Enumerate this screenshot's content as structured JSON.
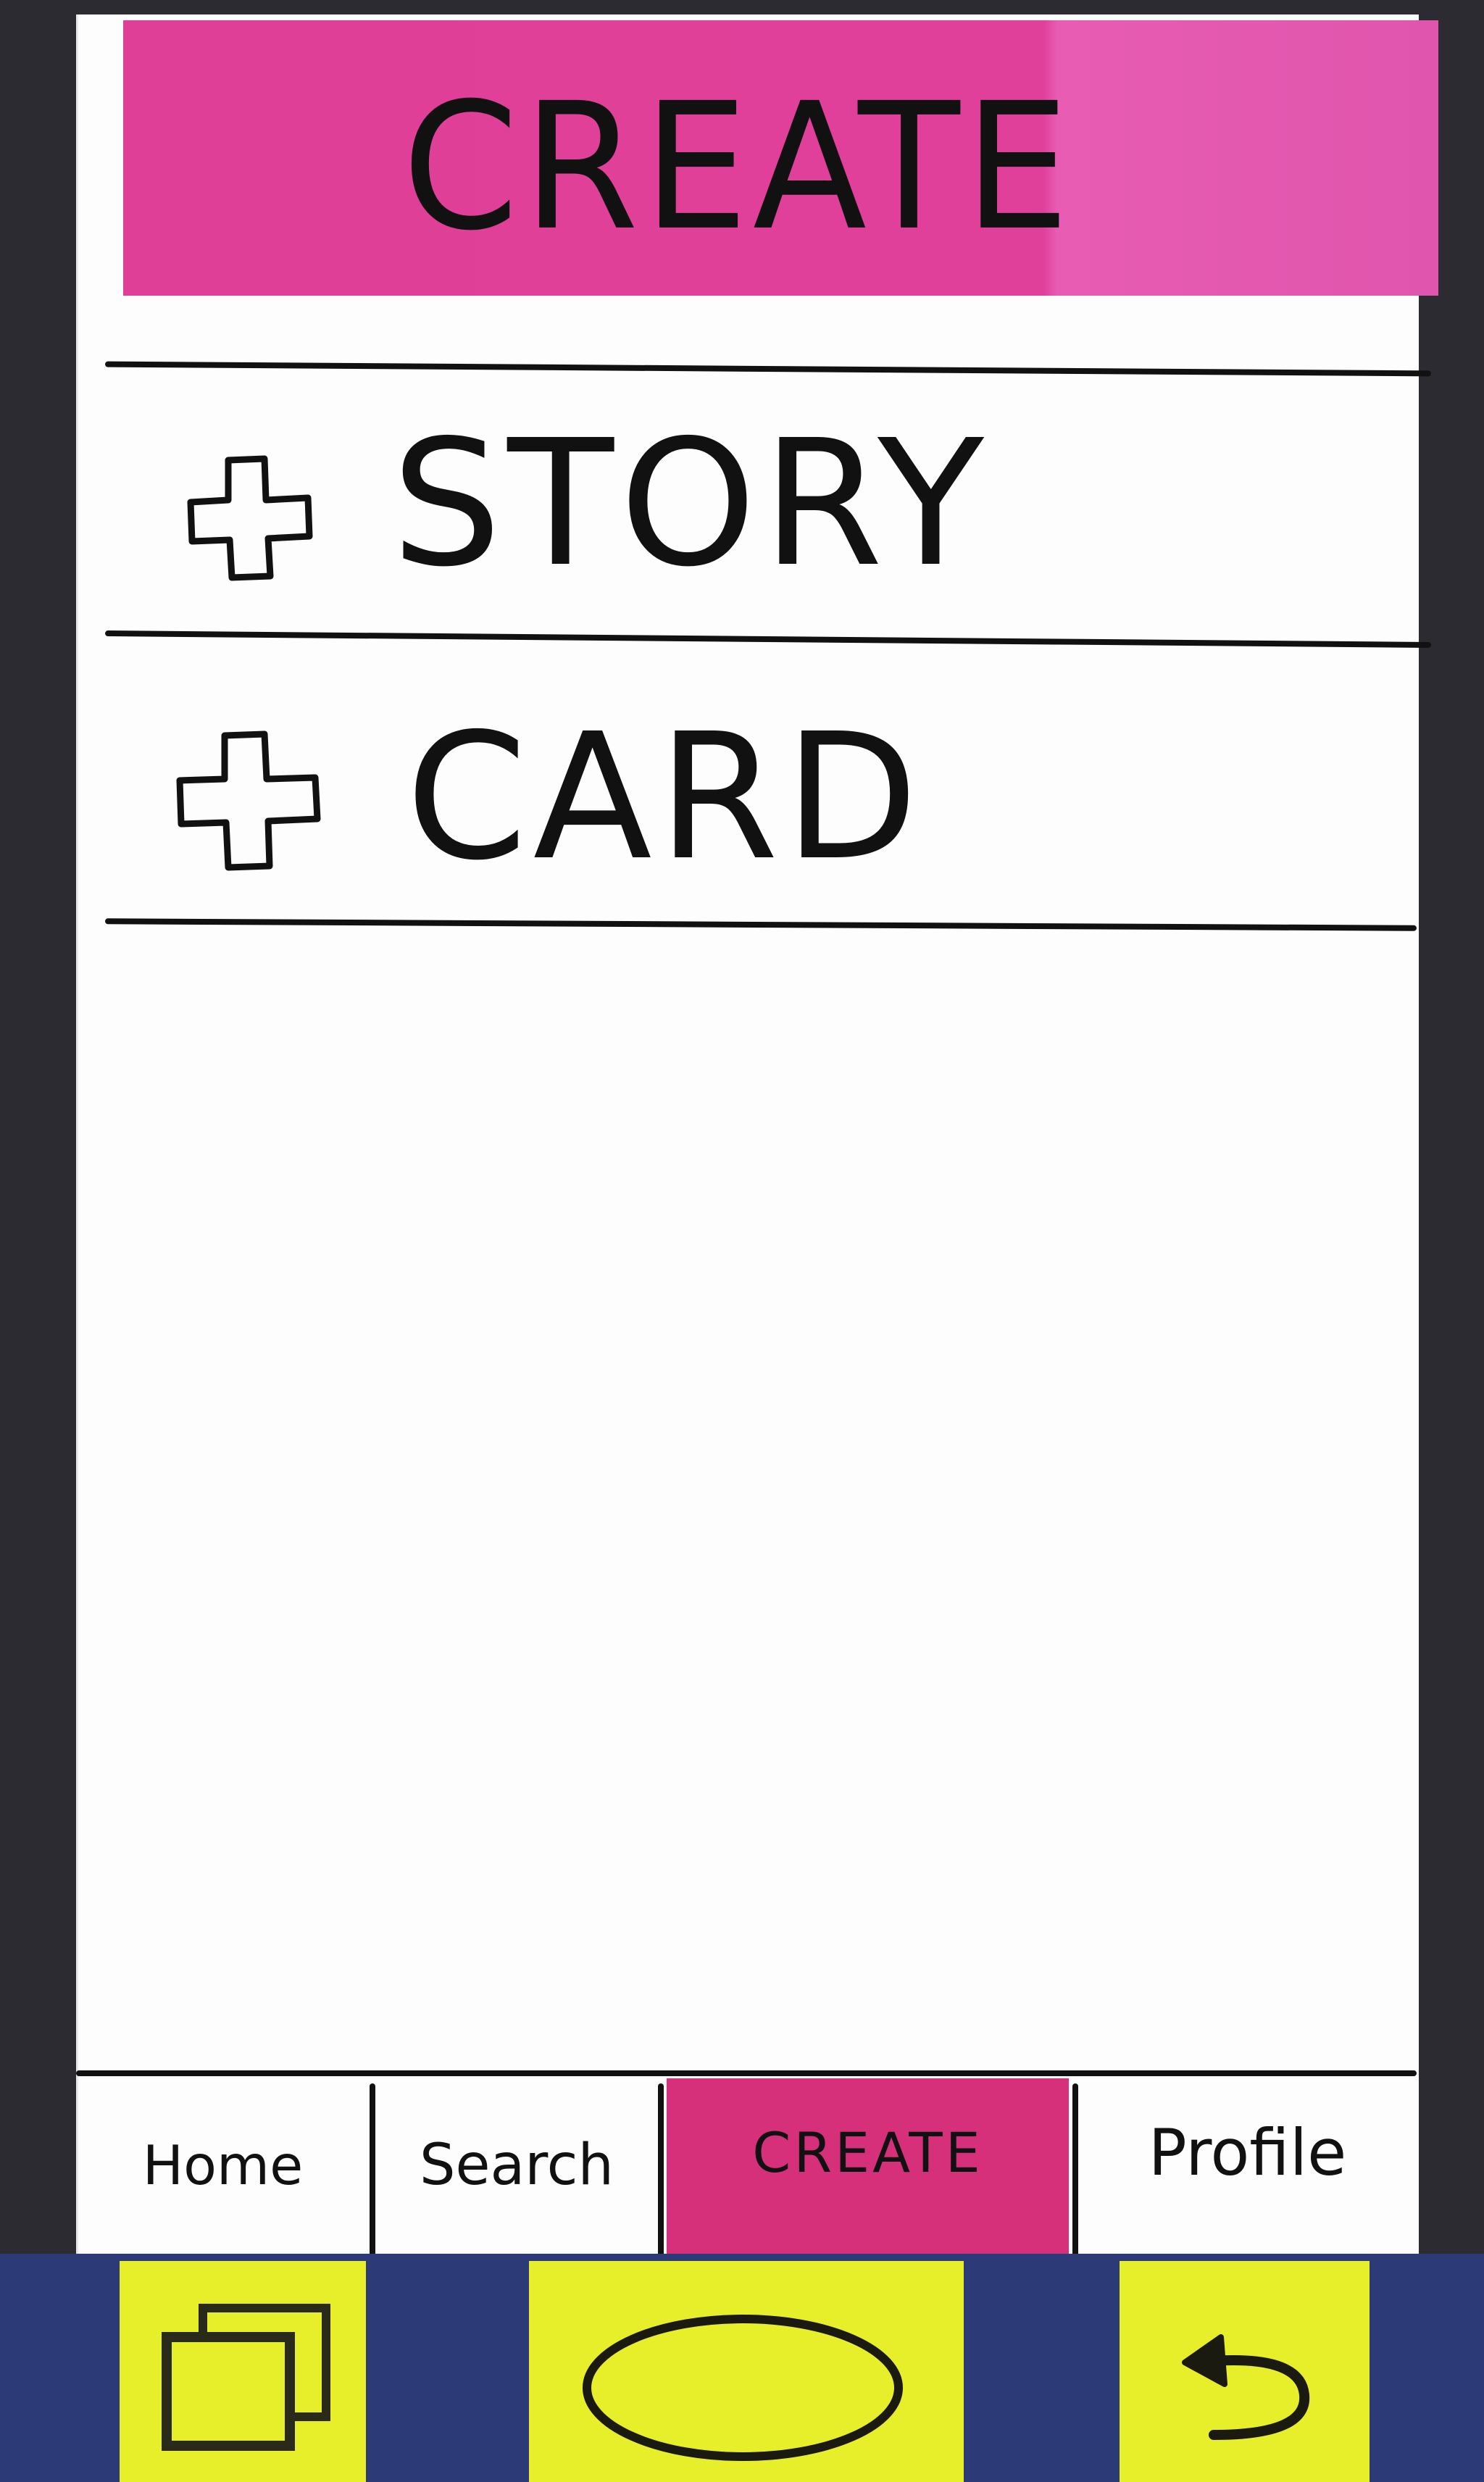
{
  "header": {
    "title": "CREATE",
    "accent_color": "#e0409a"
  },
  "options": [
    {
      "icon": "plus-icon",
      "label": "STORY"
    },
    {
      "icon": "plus-icon",
      "label": "CARD"
    }
  ],
  "bottom_nav": {
    "tabs": [
      {
        "label": "Home",
        "active": false
      },
      {
        "label": "Search",
        "active": false
      },
      {
        "label": "CREATE",
        "active": true
      },
      {
        "label": "Profile",
        "active": false
      }
    ],
    "active_color": "#d6307a"
  },
  "system_nav": {
    "buttons": [
      {
        "icon": "recent-apps-icon"
      },
      {
        "icon": "home-oval-icon"
      },
      {
        "icon": "back-arrow-icon"
      }
    ],
    "bar_color": "#2d3a78",
    "button_color": "#e7ef2b"
  }
}
